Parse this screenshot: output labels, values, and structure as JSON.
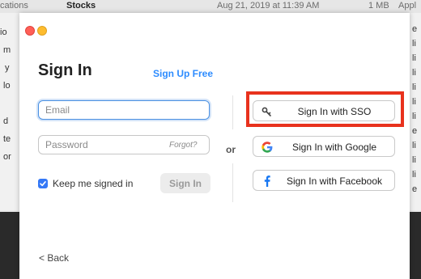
{
  "background": {
    "top_bar": {
      "left_fragment": "cations",
      "file_name": "Stocks",
      "date": "Aug 21, 2019 at 11:39 AM",
      "size": "1 MB",
      "kind": "Appl"
    },
    "left_fragments": [
      "io",
      "m",
      "y",
      "lo",
      "d",
      "te",
      "or"
    ],
    "right_fragments": [
      "e",
      "li",
      "li",
      "li",
      "li",
      "li",
      "li",
      "e",
      "li",
      "li",
      "li",
      "e"
    ]
  },
  "window": {
    "title": "Sign In",
    "signup_link": "Sign Up Free",
    "email_placeholder": "Email",
    "password_placeholder": "Password",
    "forgot_label": "Forgot?",
    "keep_signed_in_label": "Keep me signed in",
    "keep_signed_in_checked": true,
    "signin_button": "Sign In",
    "or_label": "or",
    "sso_buttons": {
      "sso": "Sign In with SSO",
      "google": "Sign In with Google",
      "facebook": "Sign In with Facebook"
    },
    "back_label": "< Back"
  },
  "colors": {
    "accent": "#2d8cff",
    "highlight": "#e8321d",
    "checkbox": "#3478f6",
    "facebook": "#1877f2"
  },
  "icons": {
    "sso": "key-icon",
    "google": "google-icon",
    "facebook": "facebook-icon"
  }
}
